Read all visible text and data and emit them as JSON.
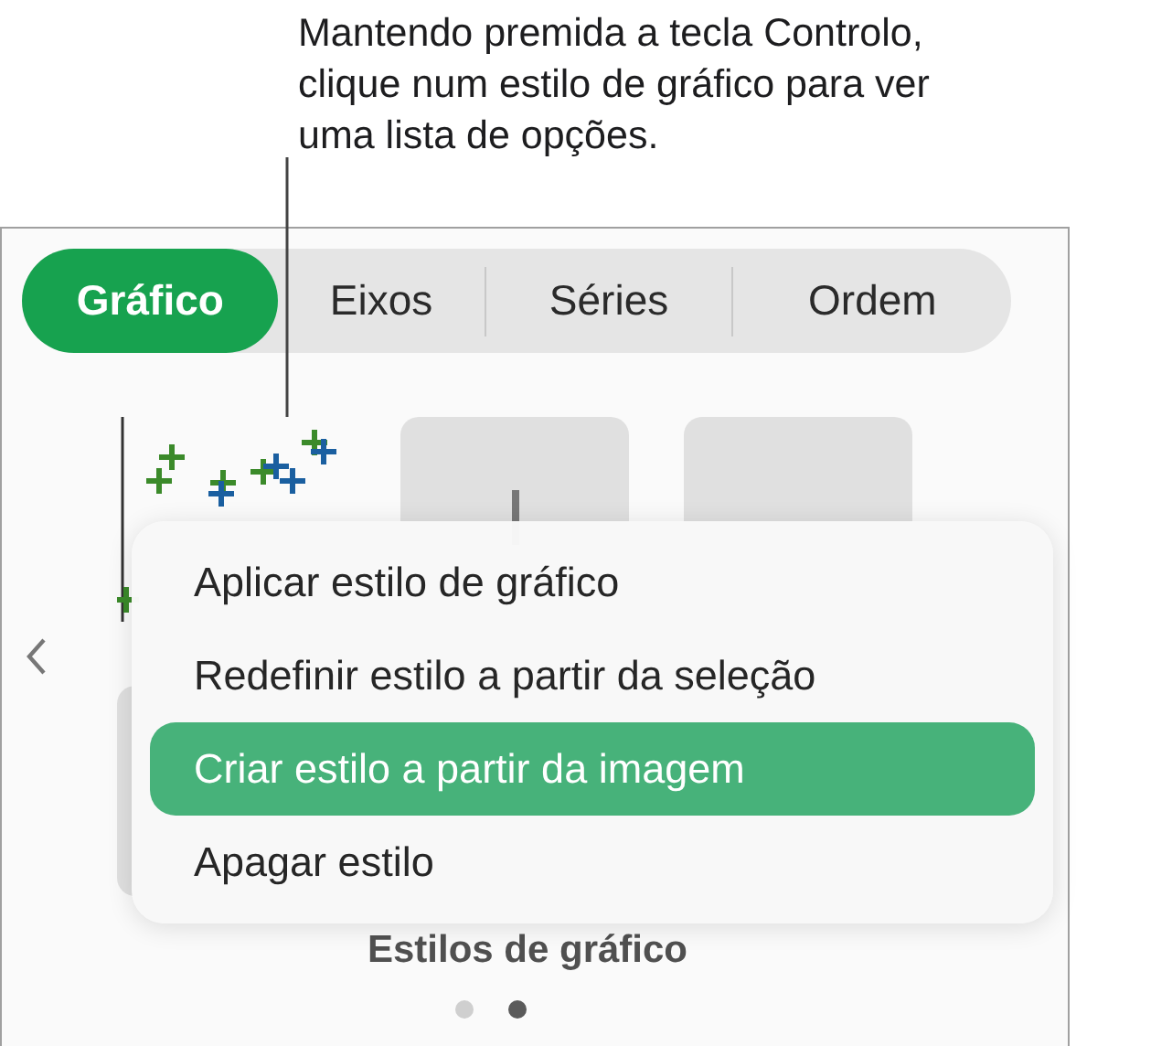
{
  "callout": {
    "lines": [
      "Mantendo premida a tecla Controlo,",
      "clique num estilo de gráfico para ver",
      "uma lista de opções."
    ]
  },
  "tabs": [
    {
      "label": "Gráfico",
      "selected": true
    },
    {
      "label": "Eixos",
      "selected": false
    },
    {
      "label": "Séries",
      "selected": false
    },
    {
      "label": "Ordem",
      "selected": false
    }
  ],
  "context_menu": {
    "items": [
      {
        "label": "Aplicar estilo de gráfico",
        "selected": false
      },
      {
        "label": "Redefinir estilo a partir da seleção",
        "selected": false
      },
      {
        "label": "Criar estilo a partir da imagem",
        "selected": true
      },
      {
        "label": "Apagar estilo",
        "selected": false
      }
    ]
  },
  "section_title": "Estilos de gráfico",
  "pages": [
    {
      "selected": false
    },
    {
      "selected": true
    }
  ]
}
